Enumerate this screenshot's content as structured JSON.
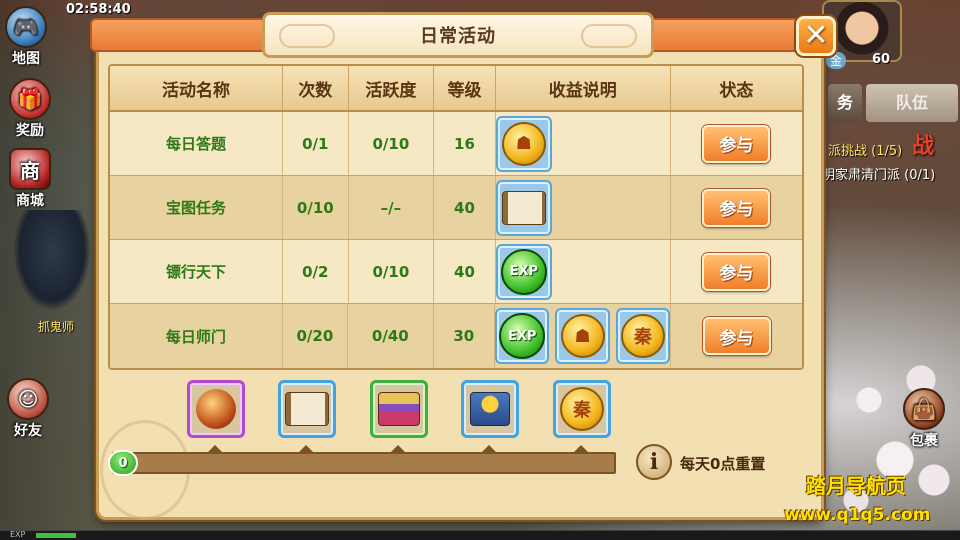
{
  "hud": {
    "clock": "02:58:40",
    "map": "地图",
    "reward": "奖励",
    "shop": "商城",
    "shop_glyph": "商",
    "friend": "好友",
    "ghost_label": "抓鬼师",
    "level": "60",
    "gold": "金",
    "mission_tab": "务",
    "team_tab": "队伍",
    "quest1": "派挑战 (1/5)",
    "quest2": "明家肃清门派 (0/1)",
    "war_glyph": "战",
    "bag": "包裹",
    "exp_label": "EXP"
  },
  "panel": {
    "title": "日常活动",
    "close_symbol": "✕"
  },
  "table": {
    "headers": {
      "name": "活动名称",
      "times": "次数",
      "active": "活跃度",
      "level": "等级",
      "reward": "收益说明",
      "status": "状态"
    },
    "rows": [
      {
        "name": "每日答题",
        "times": "0/1",
        "active": "0/10",
        "level": "16",
        "join": "参与"
      },
      {
        "name": "宝图任务",
        "times": "0/10",
        "active": "–/–",
        "level": "40",
        "join": "参与"
      },
      {
        "name": "镖行天下",
        "times": "0/2",
        "active": "0/10",
        "level": "40",
        "join": "参与"
      },
      {
        "name": "每日师门",
        "times": "0/20",
        "active": "0/40",
        "level": "30",
        "join": "参与"
      }
    ]
  },
  "icons": {
    "exp_text": "EXP",
    "qin_coin": "秦"
  },
  "progress": {
    "value": "0",
    "reset_note": "每天0点重置",
    "info_symbol": "i"
  },
  "watermark": {
    "line1": "踏月导航页",
    "line2": "www.q1q5.com"
  }
}
